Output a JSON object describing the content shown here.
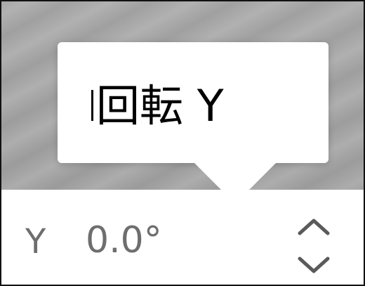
{
  "tooltip": {
    "text": "回転 Y"
  },
  "rotation_control": {
    "axis_label": "Y",
    "value": "0.0°",
    "stepper_up_icon": "chevron-up-icon",
    "stepper_down_icon": "chevron-down-icon"
  }
}
